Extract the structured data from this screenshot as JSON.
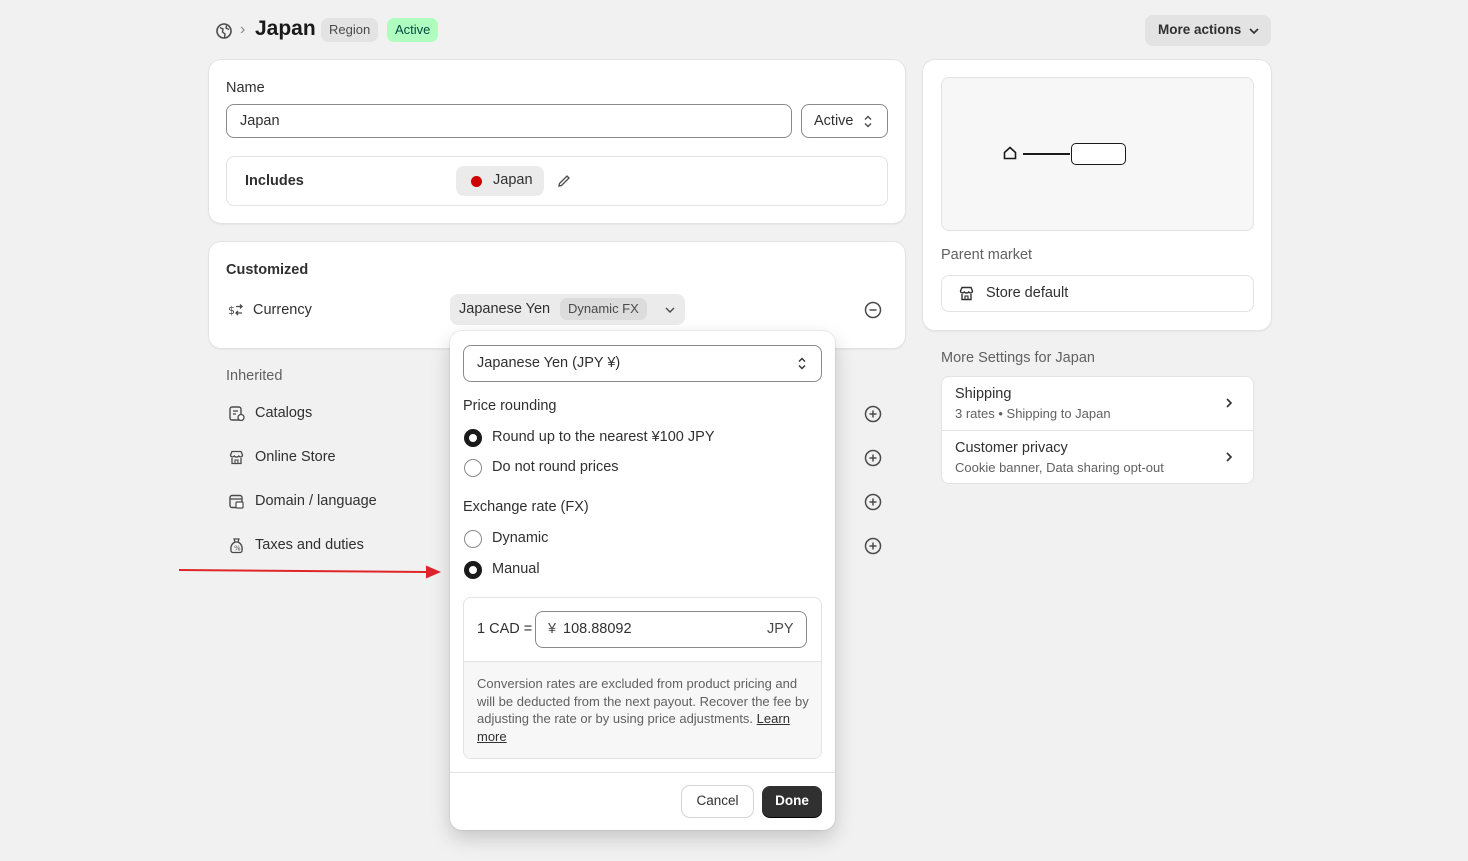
{
  "header": {
    "title": "Japan",
    "badge_region": "Region",
    "badge_active": "Active",
    "more_actions": "More actions"
  },
  "name_card": {
    "name_label": "Name",
    "name_value": "Japan",
    "status_value": "Active",
    "includes_label": "Includes",
    "includes_country": "Japan"
  },
  "customized": {
    "title": "Customized",
    "currency_label": "Currency",
    "currency_value": "Japanese Yen",
    "currency_badge": "Dynamic FX"
  },
  "inherited": {
    "title": "Inherited",
    "items": [
      {
        "label": "Catalogs",
        "icon": "catalog-icon"
      },
      {
        "label": "Online Store",
        "icon": "online-store-icon"
      },
      {
        "label": "Domain / language",
        "icon": "domain-icon"
      },
      {
        "label": "Taxes and duties",
        "icon": "taxes-icon"
      }
    ]
  },
  "popover": {
    "currency_select": "Japanese Yen (JPY ¥)",
    "price_rounding_title": "Price rounding",
    "rounding_options": [
      {
        "label": "Round up to the nearest ¥100 JPY",
        "selected": true
      },
      {
        "label": "Do not round prices",
        "selected": false
      }
    ],
    "fx_title": "Exchange rate (FX)",
    "fx_options": [
      {
        "label": "Dynamic",
        "selected": false
      },
      {
        "label": "Manual",
        "selected": true
      }
    ],
    "rate_prefix": "1 CAD =",
    "rate_symbol": "¥",
    "rate_value": "108.88092",
    "rate_suffix": "JPY",
    "note": "Conversion rates are excluded from product pricing and will be deducted from the next payout. Recover the fee by adjusting the rate or by using price adjustments.",
    "learn_more": "Learn more",
    "cancel": "Cancel",
    "done": "Done"
  },
  "sidebar": {
    "parent_market_label": "Parent market",
    "parent_market_value": "Store default",
    "more_settings_title": "More Settings for Japan",
    "settings": [
      {
        "title": "Shipping",
        "subtitle": "3 rates • Shipping to Japan"
      },
      {
        "title": "Customer privacy",
        "subtitle": "Cookie banner, Data sharing opt-out"
      }
    ]
  },
  "colors": {
    "active_badge_bg": "#affebf",
    "active_badge_text": "#014b40",
    "flag_red": "#d00000",
    "arrow_red": "#e0252a",
    "done_bg": "#303030"
  }
}
